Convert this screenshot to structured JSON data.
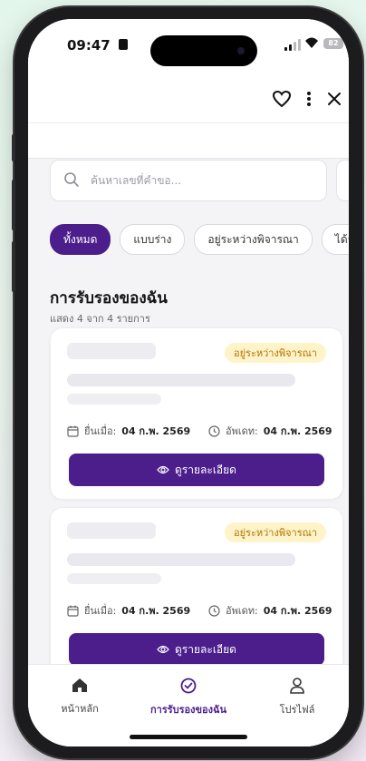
{
  "status_bar": {
    "time": "09:47",
    "battery": "82"
  },
  "search": {
    "placeholder": "ค้นหาเลขที่คำขอ..."
  },
  "chips": [
    {
      "label": "ทั้งหมด"
    },
    {
      "label": "แบบร่าง"
    },
    {
      "label": "อยู่ระหว่างพิจารณา"
    },
    {
      "label": "ได้รับการ"
    }
  ],
  "section": {
    "title": "การรับรองของฉัน",
    "subtitle": "แสดง 4 จาก 4 รายการ"
  },
  "cards": [
    {
      "status": "อยู่ระหว่างพิจารณา",
      "submitted_label": "ยื่นเมื่อ:",
      "submitted_value": "04 ก.พ. 2569",
      "updated_label": "อัพเดท:",
      "updated_value": "04 ก.พ. 2569",
      "button_label": "ดูรายละเอียด"
    },
    {
      "status": "อยู่ระหว่างพิจารณา",
      "submitted_label": "ยื่นเมื่อ:",
      "submitted_value": "04 ก.พ. 2569",
      "updated_label": "อัพเดท:",
      "updated_value": "04 ก.พ. 2569",
      "button_label": "ดูรายละเอียด"
    }
  ],
  "bottom_nav": [
    {
      "label": "หน้าหลัก",
      "icon": "home-icon"
    },
    {
      "label": "การรับรองของฉัน",
      "icon": "check-circle-icon"
    },
    {
      "label": "โปรไฟล์",
      "icon": "user-icon"
    }
  ],
  "colors": {
    "accent": "#4b1e8c",
    "badge_bg": "#fff3c9",
    "badge_text": "#b07300"
  }
}
